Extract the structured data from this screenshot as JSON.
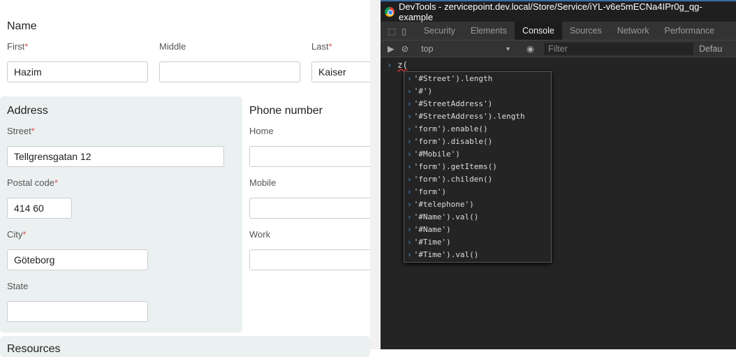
{
  "form": {
    "name_heading": "Name",
    "first_label": "First",
    "first_value": "Hazim",
    "middle_label": "Middle",
    "middle_value": "",
    "last_label": "Last",
    "last_value": "Kaiser",
    "address_heading": "Address",
    "street_label": "Street",
    "street_value": "Tellgrensgatan 12",
    "postal_label": "Postal code",
    "postal_value": "414 60",
    "city_label": "City",
    "city_value": "Göteborg",
    "state_label": "State",
    "state_value": "",
    "phone_heading": "Phone number",
    "home_label": "Home",
    "mobile_label": "Mobile",
    "work_label": "Work",
    "resources_heading": "Resources",
    "required_mark": "*"
  },
  "devtools": {
    "title": "DevTools - zervicepoint.dev.local/Store/Service/iYL-v6e5mECNa4IPr0g_qg-example",
    "tabs": [
      "Security",
      "Elements",
      "Console",
      "Sources",
      "Network",
      "Performance"
    ],
    "active_tab": "Console",
    "context": "top",
    "filter_placeholder": "Filter",
    "levels": "Defau",
    "input": "z(",
    "suggestions": [
      "'#Street').length",
      "'#')",
      "'#StreetAddress')",
      "'#StreetAddress').length",
      "'form').enable()",
      "'form').disable()",
      "'#Mobile')",
      "'form').getItems()",
      "'form').childen()",
      "'form')",
      "'#telephone')",
      "'#Name').val()",
      "'#Name')",
      "'#Time')",
      "'#Time').val()"
    ]
  }
}
